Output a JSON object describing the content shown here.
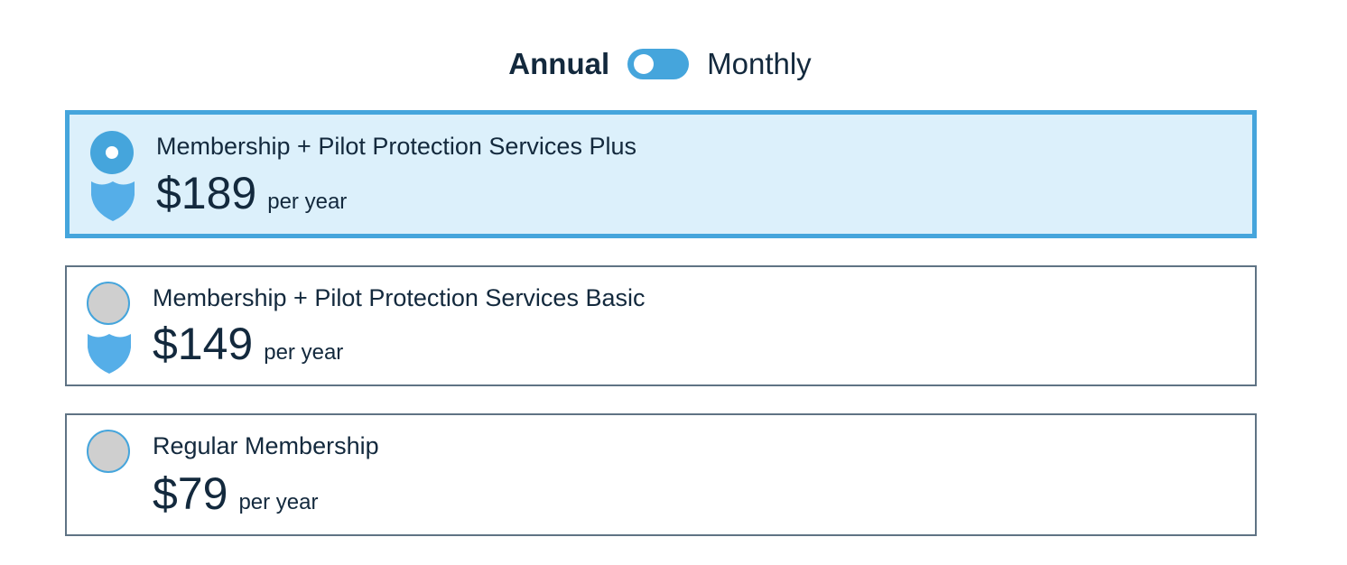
{
  "billing_toggle": {
    "annual_label": "Annual",
    "monthly_label": "Monthly",
    "selected": "Annual"
  },
  "plans": [
    {
      "name": "Membership + Pilot Protection Services Plus",
      "price": "$189",
      "period": "per year",
      "selected": true,
      "icon": "shield-icon"
    },
    {
      "name": "Membership + Pilot Protection Services Basic",
      "price": "$149",
      "period": "per year",
      "selected": false,
      "icon": "shield-icon"
    },
    {
      "name": "Regular Membership",
      "price": "$79",
      "period": "per year",
      "selected": false
    }
  ],
  "colors": {
    "accent": "#45a5dc",
    "selected_background": "#dcf0fb",
    "text": "#13293d",
    "border": "#5f7384",
    "radio_unselected": "#cfcfcf",
    "shield": "#55aee8"
  }
}
